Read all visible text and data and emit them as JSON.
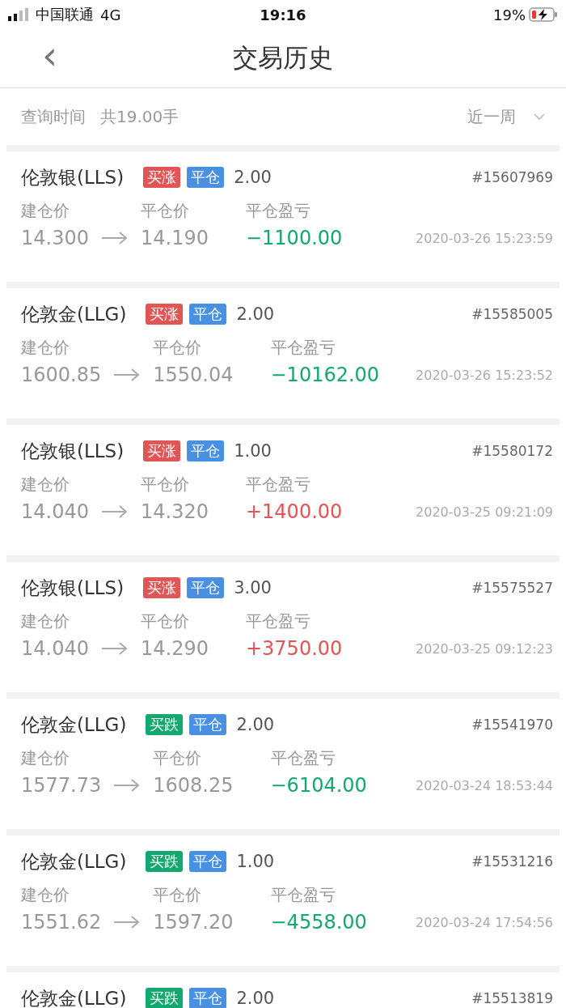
{
  "status_bar": {
    "carrier": "中国联通",
    "network": "4G",
    "time": "19:16",
    "battery": "19%"
  },
  "nav": {
    "back": "‹",
    "title": "交易历史"
  },
  "filter": {
    "label": "查询时间",
    "total": "共19.00手",
    "period": "近一周"
  },
  "trades": [
    {
      "name": "伦敦银(LLS)",
      "side": {
        "label": "买涨",
        "color": "#e25555"
      },
      "status": {
        "label": "平仓",
        "color": "#4a90e2"
      },
      "lots": "2.00",
      "order": "#15607969",
      "open_label": "建仓价",
      "close_label": "平仓价",
      "pnl_label": "平仓盈亏",
      "open": "14.300",
      "close": "14.190",
      "pnl": {
        "value": "−1100.00",
        "color": "#13a86f"
      },
      "time": "2020-03-26 15:23:59"
    },
    {
      "name": "伦敦金(LLG)",
      "side": {
        "label": "买涨",
        "color": "#e25555"
      },
      "status": {
        "label": "平仓",
        "color": "#4a90e2"
      },
      "lots": "2.00",
      "order": "#15585005",
      "open_label": "建仓价",
      "close_label": "平仓价",
      "pnl_label": "平仓盈亏",
      "open": "1600.85",
      "close": "1550.04",
      "pnl": {
        "value": "−10162.00",
        "color": "#13a86f"
      },
      "time": "2020-03-26 15:23:52"
    },
    {
      "name": "伦敦银(LLS)",
      "side": {
        "label": "买涨",
        "color": "#e25555"
      },
      "status": {
        "label": "平仓",
        "color": "#4a90e2"
      },
      "lots": "1.00",
      "order": "#15580172",
      "open_label": "建仓价",
      "close_label": "平仓价",
      "pnl_label": "平仓盈亏",
      "open": "14.040",
      "close": "14.320",
      "pnl": {
        "value": "+1400.00",
        "color": "#e25555"
      },
      "time": "2020-03-25 09:21:09"
    },
    {
      "name": "伦敦银(LLS)",
      "side": {
        "label": "买涨",
        "color": "#e25555"
      },
      "status": {
        "label": "平仓",
        "color": "#4a90e2"
      },
      "lots": "3.00",
      "order": "#15575527",
      "open_label": "建仓价",
      "close_label": "平仓价",
      "pnl_label": "平仓盈亏",
      "open": "14.040",
      "close": "14.290",
      "pnl": {
        "value": "+3750.00",
        "color": "#e25555"
      },
      "time": "2020-03-25 09:12:23"
    },
    {
      "name": "伦敦金(LLG)",
      "side": {
        "label": "买跌",
        "color": "#13a86f"
      },
      "status": {
        "label": "平仓",
        "color": "#4a90e2"
      },
      "lots": "2.00",
      "order": "#15541970",
      "open_label": "建仓价",
      "close_label": "平仓价",
      "pnl_label": "平仓盈亏",
      "open": "1577.73",
      "close": "1608.25",
      "pnl": {
        "value": "−6104.00",
        "color": "#13a86f"
      },
      "time": "2020-03-24 18:53:44"
    },
    {
      "name": "伦敦金(LLG)",
      "side": {
        "label": "买跌",
        "color": "#13a86f"
      },
      "status": {
        "label": "平仓",
        "color": "#4a90e2"
      },
      "lots": "1.00",
      "order": "#15531216",
      "open_label": "建仓价",
      "close_label": "平仓价",
      "pnl_label": "平仓盈亏",
      "open": "1551.62",
      "close": "1597.20",
      "pnl": {
        "value": "−4558.00",
        "color": "#13a86f"
      },
      "time": "2020-03-24 17:54:56"
    },
    {
      "name": "伦敦金(LLG)",
      "side": {
        "label": "买跌",
        "color": "#13a86f"
      },
      "status": {
        "label": "平仓",
        "color": "#4a90e2"
      },
      "lots": "2.00",
      "order": "#15513819"
    }
  ]
}
